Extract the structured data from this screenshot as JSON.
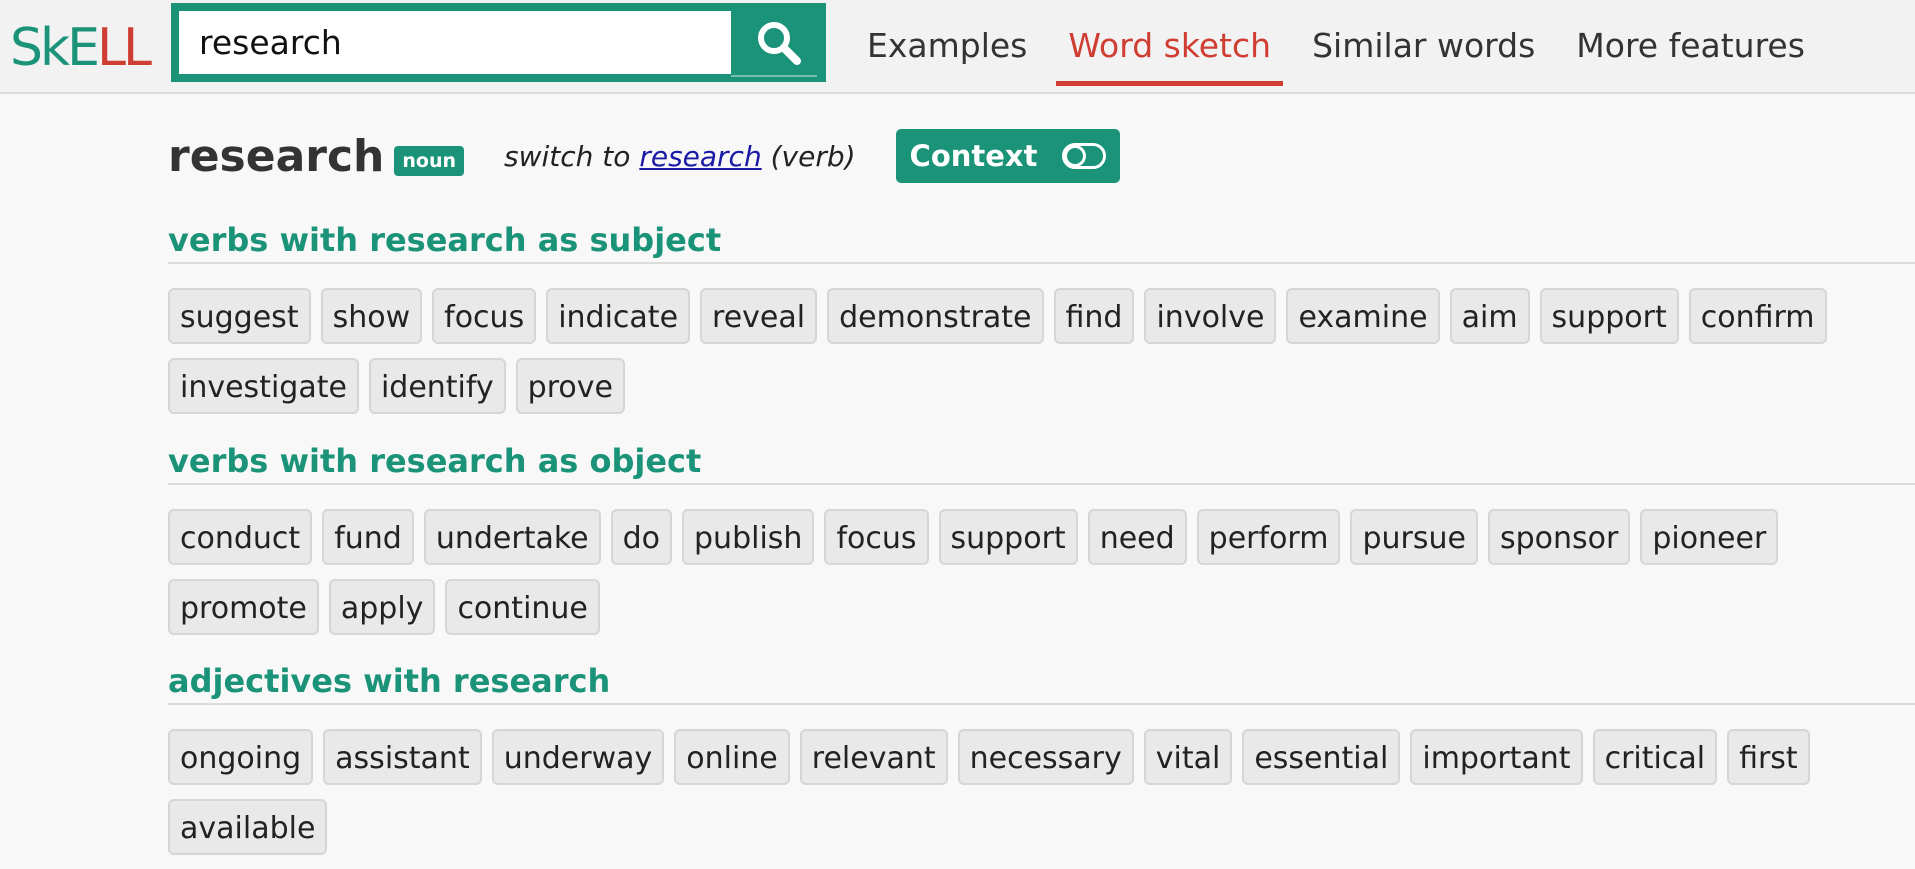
{
  "logo": {
    "sk": "SkE",
    "ll": "LL"
  },
  "search": {
    "value": "research",
    "button_icon": "search-icon"
  },
  "nav": [
    {
      "label": "Examples",
      "active": false
    },
    {
      "label": "Word sketch",
      "active": true
    },
    {
      "label": "Similar words",
      "active": false
    },
    {
      "label": "More features",
      "active": false
    }
  ],
  "entry": {
    "headword": "research",
    "pos": "noun",
    "switch_prefix": "switch to",
    "switch_link": "research",
    "switch_suffix": "(verb)",
    "context_label": "Context"
  },
  "sections": [
    {
      "title": "verbs with research as subject",
      "words": [
        "suggest",
        "show",
        "focus",
        "indicate",
        "reveal",
        "demonstrate",
        "find",
        "involve",
        "examine",
        "aim",
        "support",
        "confirm",
        "investigate",
        "identify",
        "prove"
      ]
    },
    {
      "title": "verbs with research as object",
      "words": [
        "conduct",
        "fund",
        "undertake",
        "do",
        "publish",
        "focus",
        "support",
        "need",
        "perform",
        "pursue",
        "sponsor",
        "pioneer",
        "promote",
        "apply",
        "continue"
      ]
    },
    {
      "title": "adjectives with research",
      "words": [
        "ongoing",
        "assistant",
        "underway",
        "online",
        "relevant",
        "necessary",
        "vital",
        "essential",
        "important",
        "critical",
        "first",
        "available"
      ]
    }
  ],
  "colors": {
    "accent": "#1a9378",
    "active_red": "#cf3d33"
  }
}
